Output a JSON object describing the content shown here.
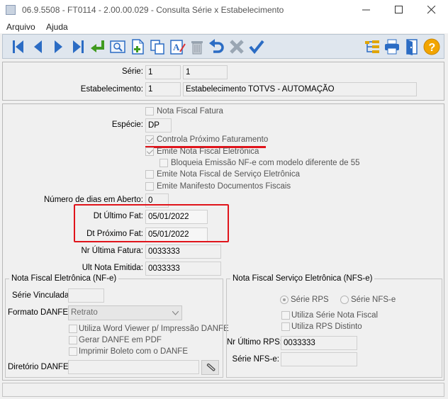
{
  "window": {
    "title": "06.9.5508 - FT0114 - 2.00.00.029 - Consulta Série x Estabelecimento"
  },
  "menu": {
    "items": [
      "Arquivo",
      "Ajuda"
    ]
  },
  "toolbar": {
    "icons": [
      "first-icon",
      "previous-icon",
      "next-icon",
      "last-icon",
      "goto-icon",
      "search-icon",
      "new-icon",
      "copy-icon",
      "edit-icon",
      "delete-icon",
      "undo-icon",
      "cancel-icon",
      "confirm-icon",
      "navigation-tree-icon",
      "print-icon",
      "exit-icon",
      "help-icon"
    ],
    "help_glyph": "?"
  },
  "header": {
    "serie_label": "Série:",
    "serie_value1": "1",
    "serie_value2": "1",
    "estab_label": "Estabelecimento:",
    "estab_code": "1",
    "estab_name": "Estabelecimento TOTVS - AUTOMAÇÃO"
  },
  "main": {
    "nota_fiscal_fatura": "Nota Fiscal Fatura",
    "especie_label": "Espécie:",
    "especie_value": "DP",
    "controla_proximo": "Controla Próximo Faturamento",
    "emite_nfe": "Emite Nota Fiscal Eletrônica",
    "bloqueia_emissao": "Bloqueia Emissão NF-e com modelo diferente de 55",
    "emite_nfse": "Emite Nota Fiscal de Serviço Eletrônica",
    "emite_manifesto": "Emite Manifesto Documentos Fiscais",
    "dias_aberto_label": "Número de dias em Aberto:",
    "dias_aberto_value": "0",
    "dt_ultimo_label": "Dt Último Fat:",
    "dt_ultimo_value": "05/01/2022",
    "dt_proximo_label": "Dt Próximo Fat:",
    "dt_proximo_value": "05/01/2022",
    "nr_ultima_label": "Nr Última Fatura:",
    "nr_ultima_value": "0033333",
    "ult_nota_label": "Ult Nota Emitida:",
    "ult_nota_value": "0033333"
  },
  "nfe_group": {
    "title": "Nota Fiscal Eletrônica (NF-e)",
    "serie_vinculada_label": "Série Vinculada:",
    "serie_vinculada_value": "",
    "formato_label": "Formato DANFE:",
    "formato_value": "Retrato",
    "word_viewer": "Utiliza Word Viewer p/ Impressão DANFE",
    "gerar_pdf": "Gerar DANFE em PDF",
    "imprimir_boleto": "Imprimir Boleto com o DANFE",
    "diretorio_label": "Diretório DANFE:",
    "diretorio_value": ""
  },
  "nfse_group": {
    "title": "Nota Fiscal Serviço Eletrônica (NFS-e)",
    "radio_rps": "Série RPS",
    "radio_nfse": "Série NFS-e",
    "utiliza_serie": "Utiliza Série Nota Fiscal",
    "utiliza_rps": "Utiliza RPS Distinto",
    "nr_ultimo_rps_label": "Nr Último RPS:",
    "nr_ultimo_rps_value": "0033333",
    "serie_nfse_label": "Série NFS-e:",
    "serie_nfse_value": ""
  },
  "colors": {
    "annotation": "#e0141b",
    "toolbar_blue": "#2b6cc4",
    "help": "#f2a500"
  }
}
